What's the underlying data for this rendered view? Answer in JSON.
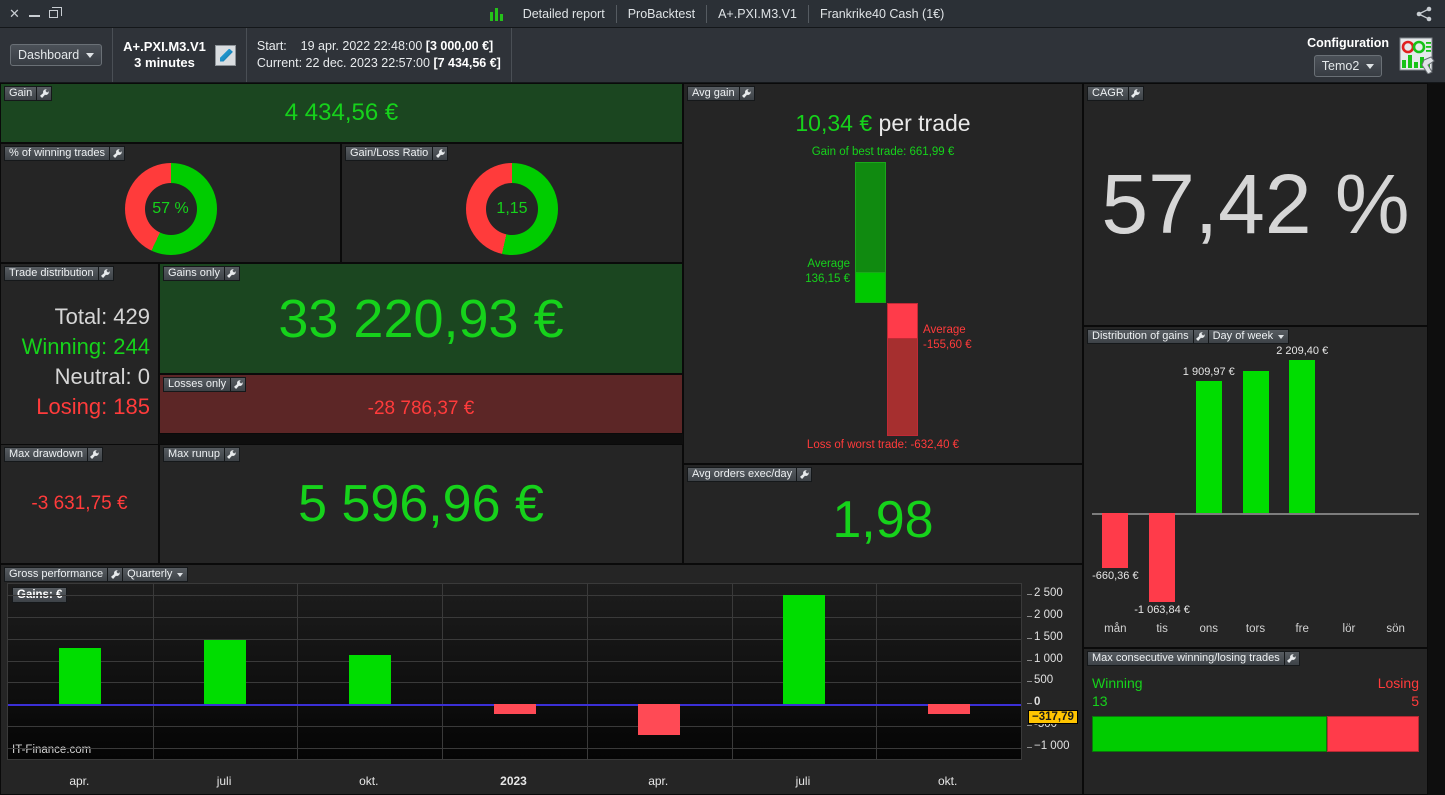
{
  "titlebar": {
    "tabs": [
      "Detailed report",
      "ProBacktest",
      "A+.PXI.M3.V1",
      "Frankrike40 Cash (1€)"
    ],
    "icons": {
      "close": "close-icon",
      "minimize": "minimize-icon",
      "restore": "restore-icon",
      "share": "share-icon",
      "candles": "candlestick-icon"
    }
  },
  "toolbar": {
    "view_selector": "Dashboard",
    "strategy_name": "A+.PXI.M3.V1",
    "strategy_timeframe": "3 minutes",
    "start_label": "Start:",
    "start_date": "19 apr. 2022 22:48:00",
    "start_capital": "[3 000,00 €]",
    "current_label": "Current:",
    "current_date": "22 dec. 2023 22:57:00",
    "current_capital": "[7 434,56 €]",
    "configuration_label": "Configuration",
    "configuration_value": "Temo2"
  },
  "panels": {
    "gain": {
      "title": "Gain",
      "value": "4 434,56 €"
    },
    "winning_pct": {
      "title": "% of winning trades",
      "value": "57 %",
      "pct": 57
    },
    "gain_loss_ratio": {
      "title": "Gain/Loss Ratio",
      "value": "1,15",
      "pct": 53.5
    },
    "trade_distribution": {
      "title": "Trade distribution",
      "rows": [
        {
          "label": "Total: 429",
          "color": "#d6d6d6"
        },
        {
          "label": "Winning: 244",
          "color": "#16d21b"
        },
        {
          "label": "Neutral: 0",
          "color": "#d6d6d6"
        },
        {
          "label": "Losing: 185",
          "color": "#ff3b3b"
        }
      ]
    },
    "gains_only": {
      "title": "Gains only",
      "value": "33 220,93 €"
    },
    "losses_only": {
      "title": "Losses only",
      "value": "-28 786,37 €"
    },
    "max_drawdown": {
      "title": "Max drawdown",
      "value": "-3 631,75 €"
    },
    "max_runup": {
      "title": "Max runup",
      "value": "5 596,96 €"
    },
    "avg_gain": {
      "title": "Avg gain",
      "headline_value": "10,34 €",
      "headline_suffix": " per trade",
      "best_trade_label": "Gain of best trade: 661,99 €",
      "avg_gain_label": "Average",
      "avg_gain_value": "136,15 €",
      "avg_loss_label": "Average",
      "avg_loss_value": "-155,60 €",
      "worst_trade_label": "Loss of worst trade: -632,40 €"
    },
    "avg_orders": {
      "title": "Avg orders exec/day",
      "value": "1,98"
    },
    "cagr": {
      "title": "CAGR",
      "value": "57,42 %"
    },
    "distribution_of_gains": {
      "title": "Distribution of gains",
      "period": "Day of week"
    },
    "max_consecutive": {
      "title": "Max consecutive winning/losing trades",
      "winning_label": "Winning",
      "winning_value": "13",
      "losing_label": "Losing",
      "losing_value": "5"
    },
    "gross_performance": {
      "title": "Gross performance",
      "period": "Quarterly",
      "series_tag": "Gains: €",
      "watermark": "IT-Finance.com",
      "current_marker": "−317,79"
    }
  },
  "chart_data": [
    {
      "type": "bar",
      "name": "distribution-of-gains-day-of-week",
      "title": "Distribution of gains",
      "subtitle": "Day of week",
      "categories": [
        "mån",
        "tis",
        "ons",
        "tors",
        "fre",
        "lör",
        "sön"
      ],
      "values": [
        -660.36,
        -1063.84,
        1909.97,
        2050.0,
        2209.4,
        0,
        0
      ],
      "labels": [
        "-660,36 €",
        "-1 063,84 €",
        "1 909,97 €",
        "",
        "2 209,40 €",
        "",
        ""
      ],
      "ylabel": "€",
      "xlabel": "",
      "ylim": [
        -1200,
        2400
      ],
      "grid": false,
      "colors": {
        "positive": "#00dd00",
        "negative": "#ff3b4a"
      }
    },
    {
      "type": "bar",
      "name": "gross-performance-quarterly",
      "title": "Gross performance",
      "subtitle": "Quarterly",
      "series_label": "Gains: €",
      "categories": [
        "2022-Q2",
        "2022-Q3",
        "2022-Q4",
        "2023-Q1",
        "2023-Q2",
        "2023-Q3",
        "2023-Q4"
      ],
      "x_tick_labels": [
        "apr.",
        "juli",
        "okt.",
        "2023",
        "apr.",
        "juli",
        "okt."
      ],
      "values": [
        1280,
        1460,
        1120,
        -230,
        -700,
        2500,
        -210
      ],
      "ylim": [
        -1250,
        2750
      ],
      "yticks": [
        2500,
        2000,
        1500,
        1000,
        500,
        0,
        -500,
        -1000
      ],
      "ytick_labels": [
        "2 500",
        "2 000",
        "1 500",
        "1 000",
        "500",
        "0",
        "-500",
        "−1 000"
      ],
      "highlight_value": "−317,79",
      "grid": true,
      "colors": {
        "positive": "#00dd00",
        "negative": "#ff4a55",
        "zeroline": "#3b2fd6"
      }
    },
    {
      "type": "bar",
      "name": "avg-gain-range",
      "title": "Avg gain",
      "categories": [
        "best/avg gain",
        "avg/worst loss"
      ],
      "values": [
        661.99,
        -632.4
      ],
      "annotations": {
        "avg_gain": 136.15,
        "avg_loss": -155.6,
        "avg_per_trade": 10.34
      },
      "ylim": [
        -632.4,
        661.99
      ]
    },
    {
      "type": "pie",
      "name": "winning-trades-donut",
      "title": "% of winning trades",
      "categories": [
        "winning",
        "losing"
      ],
      "values": [
        57,
        43
      ],
      "center_label": "57 %"
    },
    {
      "type": "pie",
      "name": "gain-loss-ratio-donut",
      "title": "Gain/Loss Ratio",
      "categories": [
        "gain",
        "loss"
      ],
      "values": [
        53.5,
        46.5
      ],
      "center_label": "1,15"
    }
  ]
}
